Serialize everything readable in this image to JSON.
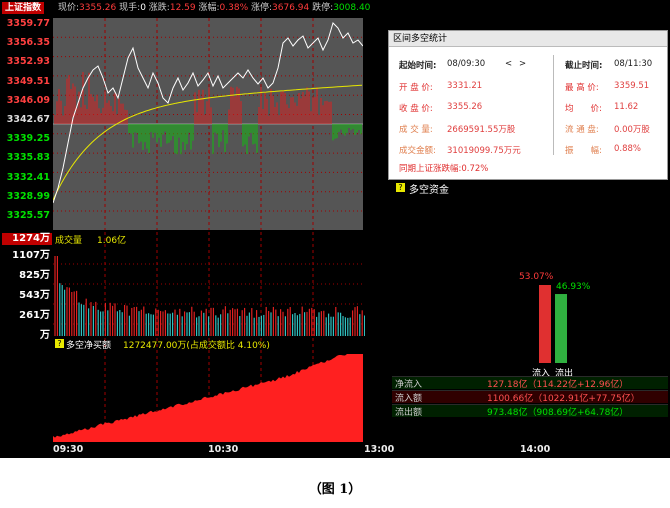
{
  "header": {
    "index_name": "上证指数",
    "price_label": "现价:",
    "price": "3355.26",
    "hand_label": "现手:",
    "hand": "0",
    "change_label": "涨跌:",
    "change": "12.59",
    "pct_label": "涨幅:",
    "pct": "0.38%",
    "limit_up_label": "涨停:",
    "limit_up": "3676.94",
    "limit_down_label": "跌停:",
    "limit_down": "3008.40"
  },
  "price_axis": [
    "3359.77",
    "3356.35",
    "3352.93",
    "3349.51",
    "3346.09",
    "3342.67",
    "3339.25",
    "3335.83",
    "3332.41",
    "3328.99",
    "3325.57"
  ],
  "volume": {
    "current": "1274万",
    "ticks": [
      "1107万",
      "825万",
      "543万",
      "261万",
      "万"
    ],
    "title": "成交量",
    "amount": "1.06亿"
  },
  "flow": {
    "title": "多空净买额",
    "value": "1272477.00万(占成交额比 4.10%)"
  },
  "time_axis": [
    "09:30",
    "10:30",
    "13:00",
    "14:00"
  ],
  "panel": {
    "title": "区间多空统计",
    "start_label": "起始时间:",
    "start": "08/09:30",
    "nav_prev": "<",
    "nav_next": ">",
    "end_label": "截止时间:",
    "end": "08/11:30",
    "rows": [
      {
        "l": "开 盘 价:",
        "lv": "3331.21",
        "r": "最 高 价:",
        "rv": "3359.51"
      },
      {
        "l": "收 盘 价:",
        "lv": "3355.26",
        "r": "均　　价:",
        "rv": "11.62"
      },
      {
        "l": "成 交 量:",
        "lv": "2669591.55万股",
        "r": "流 通 盘:",
        "rv": "0.00万股"
      },
      {
        "l": "成交金额:",
        "lv": "31019099.75万元",
        "r": "振　　幅:",
        "rv": "0.88%"
      }
    ],
    "sync": "同期上证涨跌幅:0.72%"
  },
  "fund": {
    "title": "多空资金",
    "in_pct": "53.07%",
    "out_pct": "46.93%",
    "in_label": "流入",
    "out_label": "流出",
    "rows": [
      {
        "label": "净流入",
        "value": "127.18亿（114.22亿+12.96亿）"
      },
      {
        "label": "流入额",
        "value": "1100.66亿（1022.91亿+77.75亿）"
      },
      {
        "label": "流出额",
        "value": "973.48亿（908.69亿+64.78亿）"
      }
    ]
  },
  "caption": "（图 1）",
  "chart_data": {
    "type": "line",
    "bars": {
      "in": 53.07,
      "out": 46.93
    }
  }
}
